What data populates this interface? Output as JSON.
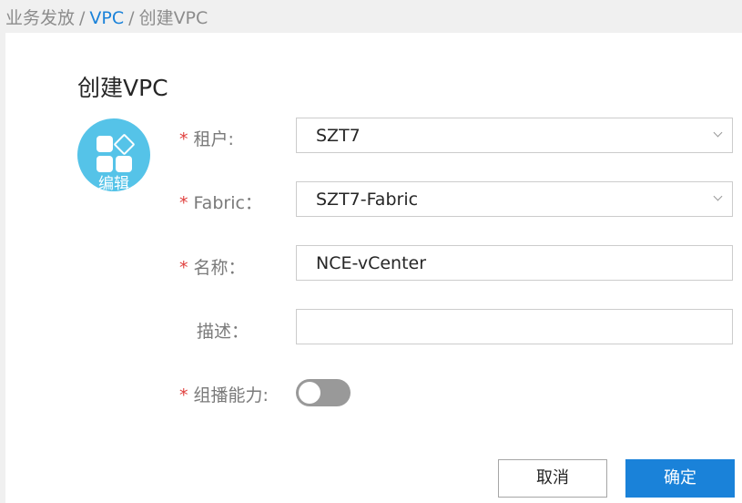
{
  "breadcrumb": {
    "root": "业务发放",
    "vpc": "VPC",
    "current": "创建VPC",
    "separator": "/"
  },
  "form": {
    "title": "创建VPC",
    "avatar_label": "编辑",
    "required_mark": "*",
    "tenant": {
      "label": "租户:",
      "value": "SZT7"
    },
    "fabric": {
      "label": "Fabric：",
      "value": "SZT7-Fabric"
    },
    "name": {
      "label": "名称：",
      "value": "NCE-vCenter"
    },
    "description": {
      "label": "描述：",
      "value": ""
    },
    "multicast": {
      "label": "组播能力:",
      "enabled": false
    }
  },
  "buttons": {
    "cancel": "取消",
    "confirm": "确定"
  },
  "colors": {
    "accent": "#1a82d9",
    "required": "#e0403e",
    "avatar": "#55c3e8",
    "toggle_off": "#999999"
  }
}
